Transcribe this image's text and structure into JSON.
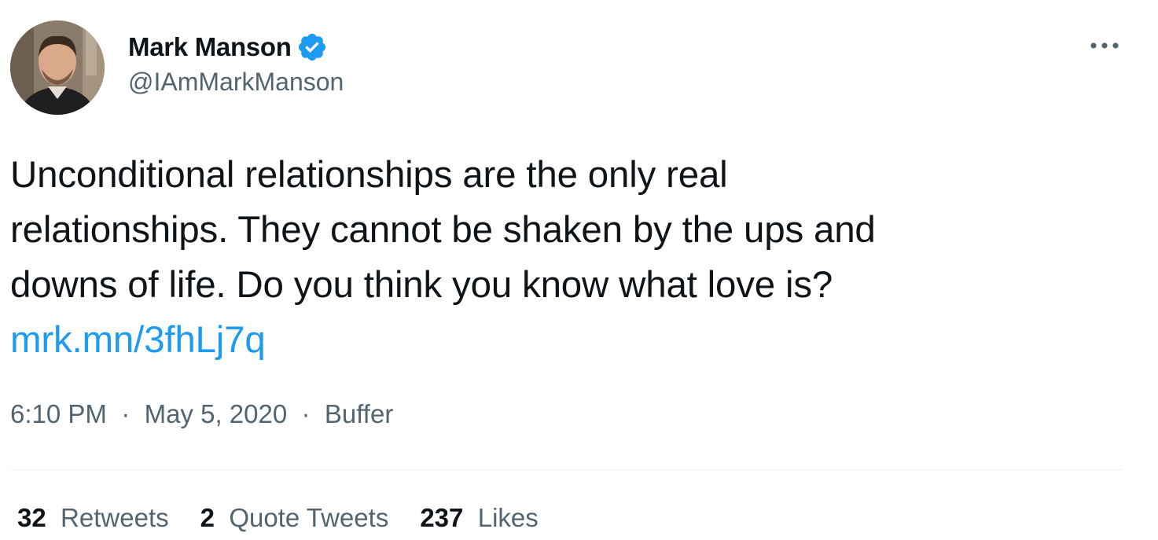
{
  "author": {
    "display_name": "Mark Manson",
    "handle": "@IAmMarkManson",
    "verified": true,
    "avatar_icon": "profile-photo"
  },
  "tweet": {
    "text_lines": [
      "Unconditional relationships are the only real",
      "relationships. They cannot be shaken by the ups and",
      "downs of life. Do you think you know what love is?"
    ],
    "link": "mrk.mn/3fhLj7q"
  },
  "meta": {
    "time": "6:10 PM",
    "separator": "·",
    "date": "May 5, 2020",
    "source": "Buffer"
  },
  "stats": [
    {
      "count": "32",
      "label": "Retweets"
    },
    {
      "count": "2",
      "label": "Quote Tweets"
    },
    {
      "count": "237",
      "label": "Likes"
    }
  ],
  "more_icon": "more-horizontal-icon",
  "colors": {
    "link": "#1d9bf0",
    "verified": "#1d9bf0",
    "secondary_text": "#536471",
    "primary_text": "#0f1419"
  }
}
